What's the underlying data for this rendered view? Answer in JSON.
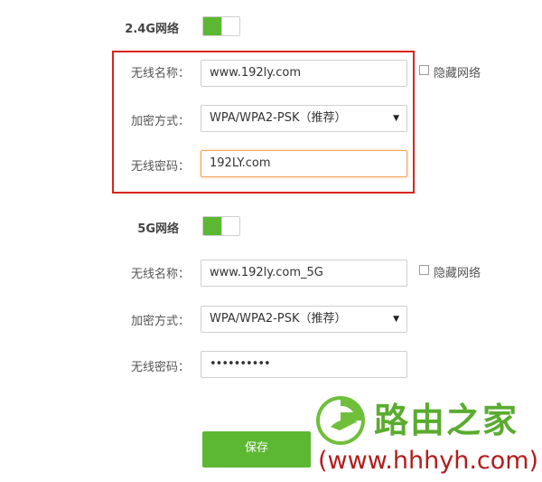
{
  "wifi24": {
    "title": "2.4G网络",
    "ssid_label": "无线名称：",
    "ssid_value": "www.192ly.com",
    "hide_label": "隐藏网络",
    "security_label": "加密方式：",
    "security_value": "WPA/WPA2-PSK（推荐）",
    "password_label": "无线密码：",
    "password_value": "192LY.com",
    "enabled": true
  },
  "wifi5": {
    "title": "5G网络",
    "ssid_label": "无线名称：",
    "ssid_value": "www.192ly.com_5G",
    "hide_label": "隐藏网络",
    "security_label": "加密方式：",
    "security_value": "WPA/WPA2-PSK（推荐）",
    "password_label": "无线密码：",
    "password_masked": "••••••••••",
    "enabled": true
  },
  "save_label": "保存",
  "watermark": {
    "brand": "路由之家",
    "url": "(www.hhhyh.com)"
  },
  "colors": {
    "accent_green": "#5cb833",
    "highlight_red": "#d9251d",
    "focus_orange": "#f3a55a"
  }
}
